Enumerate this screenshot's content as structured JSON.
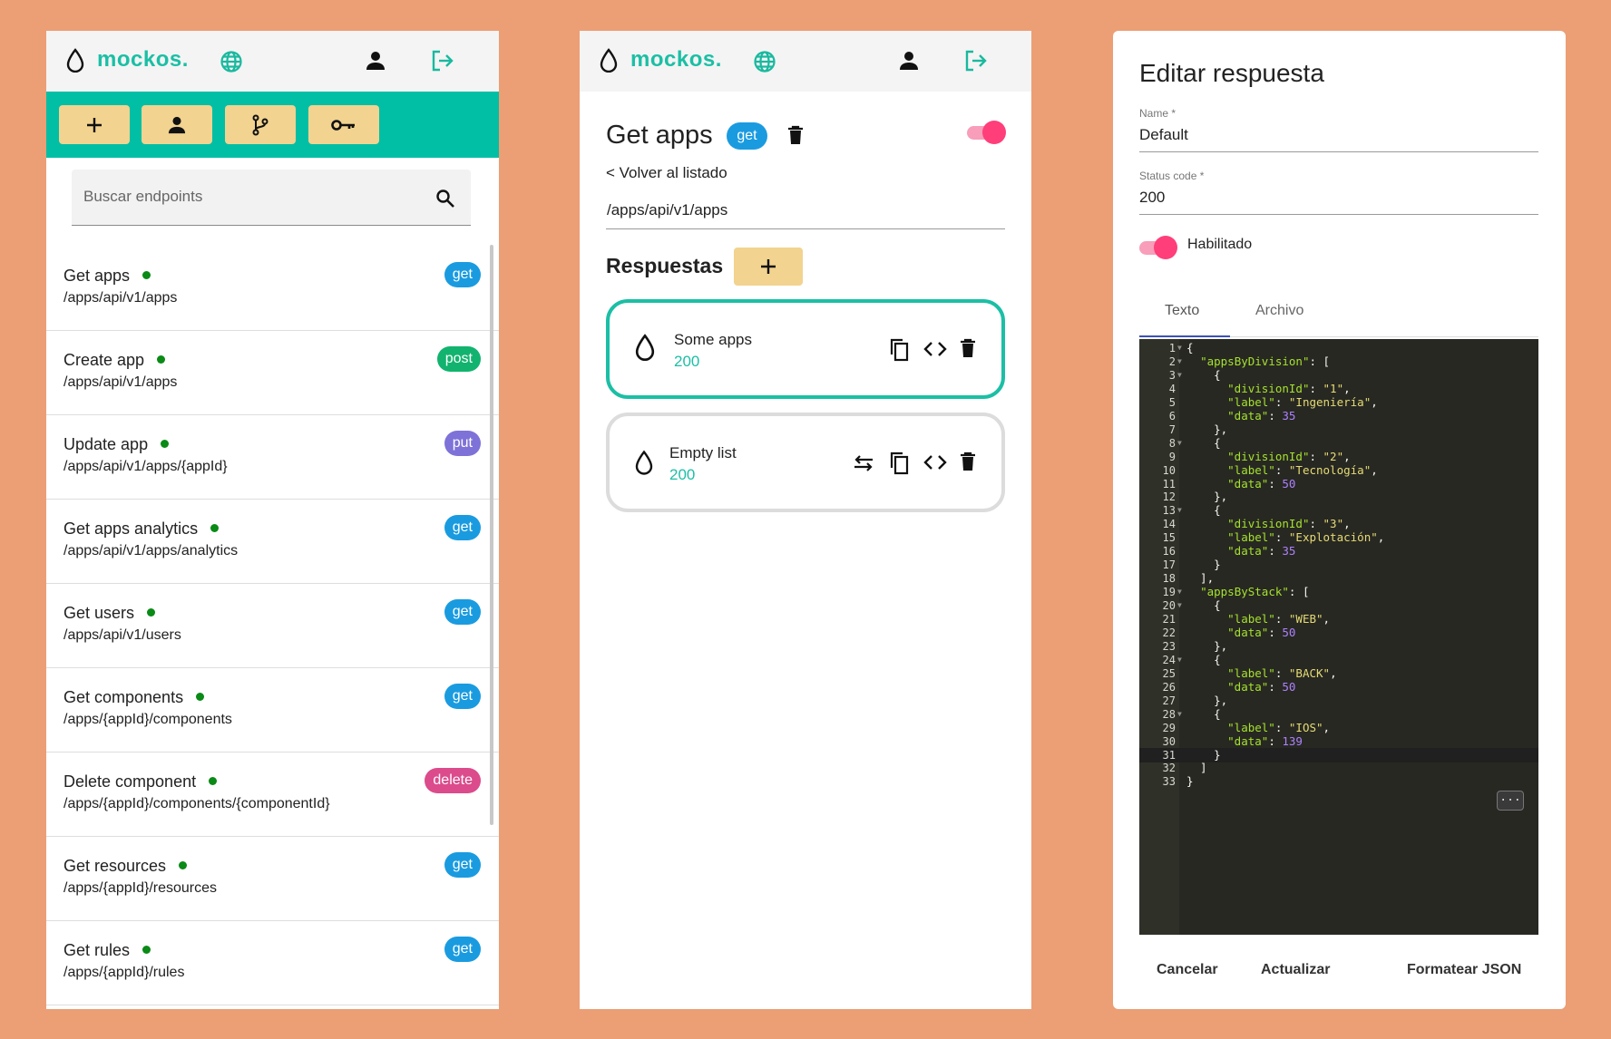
{
  "brand": {
    "name": "mockos."
  },
  "colors": {
    "background": "#EC9E75",
    "accent": "#00BFA5",
    "button": "#F2D38F",
    "get": "#1A9BE0",
    "post": "#12B36E",
    "put": "#7E72D8",
    "delete": "#DC4B8C",
    "switch": "#FF3E7A"
  },
  "icons": {
    "logo": "drop-icon",
    "language": "globe-icon",
    "user": "person-icon",
    "logout": "logout-icon",
    "add": "plus-icon",
    "users": "person-icon",
    "branch": "branch-icon",
    "key": "key-icon",
    "search": "search-icon",
    "trash": "trash-icon",
    "copy": "copy-icon",
    "code": "code-icon",
    "swap": "swap-icon"
  },
  "search": {
    "placeholder": "Buscar endpoints"
  },
  "endpoints": [
    {
      "name": "Get apps",
      "path": "/apps/api/v1/apps",
      "method": "get"
    },
    {
      "name": "Create app",
      "path": "/apps/api/v1/apps",
      "method": "post"
    },
    {
      "name": "Update app",
      "path": "/apps/api/v1/apps/{appId}",
      "method": "put"
    },
    {
      "name": "Get apps analytics",
      "path": "/apps/api/v1/apps/analytics",
      "method": "get"
    },
    {
      "name": "Get users",
      "path": "/apps/api/v1/users",
      "method": "get"
    },
    {
      "name": "Get components",
      "path": "/apps/{appId}/components",
      "method": "get"
    },
    {
      "name": "Delete component",
      "path": "/apps/{appId}/components/{componentId}",
      "method": "delete"
    },
    {
      "name": "Get resources",
      "path": "/apps/{appId}/resources",
      "method": "get"
    },
    {
      "name": "Get rules",
      "path": "/apps/{appId}/rules",
      "method": "get"
    }
  ],
  "detail": {
    "title": "Get apps",
    "method": "get",
    "back_link": "< Volver al listado",
    "path": "/apps/api/v1/apps",
    "enabled": true,
    "responses_title": "Respuestas",
    "responses": [
      {
        "name": "Some apps",
        "status": "200",
        "selected": true
      },
      {
        "name": "Empty list",
        "status": "200",
        "selected": false
      }
    ]
  },
  "dialog": {
    "title": "Editar respuesta",
    "name_label": "Name *",
    "name_value": "Default",
    "status_label": "Status code *",
    "status_value": "200",
    "enabled_label": "Habilitado",
    "tabs": [
      "Texto",
      "Archivo"
    ],
    "active_tab": "Texto",
    "active_line": 31,
    "code_lines": [
      "{",
      "  \"appsByDivision\": [",
      "    {",
      "      \"divisionId\": \"1\",",
      "      \"label\": \"Ingeniería\",",
      "      \"data\": 35",
      "    },",
      "    {",
      "      \"divisionId\": \"2\",",
      "      \"label\": \"Tecnología\",",
      "      \"data\": 50",
      "    },",
      "    {",
      "      \"divisionId\": \"3\",",
      "      \"label\": \"Explotación\",",
      "      \"data\": 35",
      "    }",
      "  ],",
      "  \"appsByStack\": [",
      "    {",
      "      \"label\": \"WEB\",",
      "      \"data\": 50",
      "    },",
      "    {",
      "      \"label\": \"BACK\",",
      "      \"data\": 50",
      "    },",
      "    {",
      "      \"label\": \"IOS\",",
      "      \"data\": 139",
      "    }",
      "  ]",
      "}"
    ],
    "fold_lines": [
      1,
      2,
      3,
      8,
      13,
      19,
      20,
      24,
      28
    ],
    "ellipsis": "...",
    "buttons": {
      "cancel": "Cancelar",
      "update": "Actualizar",
      "format": "Formatear JSON"
    }
  }
}
